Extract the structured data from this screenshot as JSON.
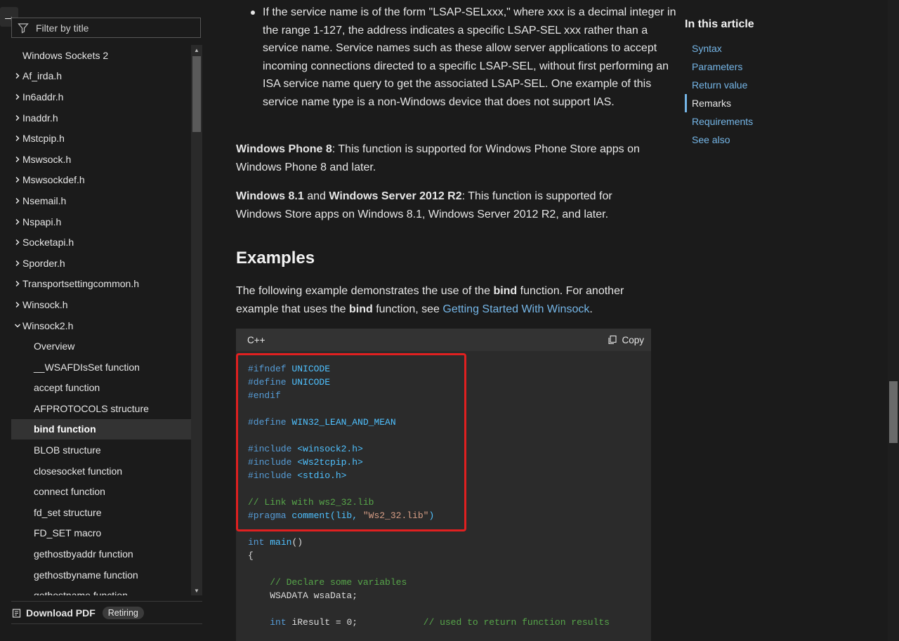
{
  "sidebar": {
    "filter_placeholder": "Filter by title",
    "items": [
      {
        "label": "Windows Sockets 2",
        "level": 0,
        "chevron": ""
      },
      {
        "label": "Af_irda.h",
        "level": 1,
        "chevron": "right"
      },
      {
        "label": "In6addr.h",
        "level": 1,
        "chevron": "right"
      },
      {
        "label": "Inaddr.h",
        "level": 1,
        "chevron": "right"
      },
      {
        "label": "Mstcpip.h",
        "level": 1,
        "chevron": "right"
      },
      {
        "label": "Mswsock.h",
        "level": 1,
        "chevron": "right"
      },
      {
        "label": "Mswsockdef.h",
        "level": 1,
        "chevron": "right"
      },
      {
        "label": "Nsemail.h",
        "level": 1,
        "chevron": "right"
      },
      {
        "label": "Nspapi.h",
        "level": 1,
        "chevron": "right"
      },
      {
        "label": "Socketapi.h",
        "level": 1,
        "chevron": "right"
      },
      {
        "label": "Sporder.h",
        "level": 1,
        "chevron": "right"
      },
      {
        "label": "Transportsettingcommon.h",
        "level": 1,
        "chevron": "right"
      },
      {
        "label": "Winsock.h",
        "level": 1,
        "chevron": "right"
      },
      {
        "label": "Winsock2.h",
        "level": 1,
        "chevron": "down"
      },
      {
        "label": "Overview",
        "level": 2,
        "chevron": ""
      },
      {
        "label": "__WSAFDIsSet function",
        "level": 2,
        "chevron": ""
      },
      {
        "label": "accept function",
        "level": 2,
        "chevron": ""
      },
      {
        "label": "AFPROTOCOLS structure",
        "level": 2,
        "chevron": ""
      },
      {
        "label": "bind function",
        "level": 2,
        "chevron": "",
        "selected": true
      },
      {
        "label": "BLOB structure",
        "level": 2,
        "chevron": ""
      },
      {
        "label": "closesocket function",
        "level": 2,
        "chevron": ""
      },
      {
        "label": "connect function",
        "level": 2,
        "chevron": ""
      },
      {
        "label": "fd_set structure",
        "level": 2,
        "chevron": ""
      },
      {
        "label": "FD_SET macro",
        "level": 2,
        "chevron": ""
      },
      {
        "label": "gethostbyaddr function",
        "level": 2,
        "chevron": ""
      },
      {
        "label": "gethostbyname function",
        "level": 2,
        "chevron": ""
      },
      {
        "label": "gethostname function",
        "level": 2,
        "chevron": ""
      }
    ],
    "download_pdf": "Download PDF",
    "retiring_badge": "Retiring"
  },
  "main": {
    "bullet_text": "If the service name is of the form \"LSAP-SELxxx,\" where xxx is a decimal integer in the range 1-127, the address indicates a specific LSAP-SEL xxx rather than a service name. Service names such as these allow server applications to accept incoming connections directed to a specific LSAP-SEL, without first performing an ISA service name query to get the associated LSAP-SEL. One example of this service name type is a non-Windows device that does not support IAS.",
    "wp8_bold": "Windows Phone 8",
    "wp8_text": ": This function is supported for Windows Phone Store apps on Windows Phone 8 and later.",
    "w81_bold": "Windows 8.1",
    "w81_and": " and ",
    "ws2012_bold": "Windows Server 2012 R2",
    "w81_text": ": This function is supported for Windows Store apps on Windows 8.1, Windows Server 2012 R2, and later.",
    "examples_heading": "Examples",
    "ex_text_1": "The following example demonstrates the use of the ",
    "ex_bold_1": "bind",
    "ex_text_2": " function. For another example that uses the ",
    "ex_bold_2": "bind",
    "ex_text_3": " function, see ",
    "ex_link": "Getting Started With Winsock",
    "ex_text_4": ".",
    "code": {
      "language": "C++",
      "copy_label": "Copy",
      "lines": [
        [
          {
            "t": "#ifndef ",
            "c": "pp"
          },
          {
            "t": "UNICODE",
            "c": "cyan"
          }
        ],
        [
          {
            "t": "#define ",
            "c": "pp"
          },
          {
            "t": "UNICODE",
            "c": "cyan"
          }
        ],
        [
          {
            "t": "#endif",
            "c": "pp"
          }
        ],
        [],
        [
          {
            "t": "#define ",
            "c": "pp"
          },
          {
            "t": "WIN32_LEAN_AND_MEAN",
            "c": "cyan"
          }
        ],
        [],
        [
          {
            "t": "#include ",
            "c": "pp"
          },
          {
            "t": "<winsock2.h>",
            "c": "cyan"
          }
        ],
        [
          {
            "t": "#include ",
            "c": "pp"
          },
          {
            "t": "<Ws2tcpip.h>",
            "c": "cyan"
          }
        ],
        [
          {
            "t": "#include ",
            "c": "pp"
          },
          {
            "t": "<stdio.h>",
            "c": "cyan"
          }
        ],
        [],
        [
          {
            "t": "// Link with ws2_32.lib",
            "c": "cm"
          }
        ],
        [
          {
            "t": "#pragma ",
            "c": "pp"
          },
          {
            "t": "comment(lib, ",
            "c": "cyan"
          },
          {
            "t": "\"Ws2_32.lib\"",
            "c": "str"
          },
          {
            "t": ")",
            "c": "cyan"
          }
        ],
        [],
        [
          {
            "t": "int ",
            "c": "kw"
          },
          {
            "t": "main",
            "c": "cyan"
          },
          {
            "t": "()",
            "c": ""
          }
        ],
        [
          {
            "t": "{",
            "c": ""
          }
        ],
        [],
        [
          {
            "t": "    ",
            "c": ""
          },
          {
            "t": "// Declare some variables",
            "c": "cm"
          }
        ],
        [
          {
            "t": "    WSADATA wsaData;",
            "c": ""
          }
        ],
        [],
        [
          {
            "t": "    ",
            "c": ""
          },
          {
            "t": "int",
            "c": "kw"
          },
          {
            "t": " iResult = 0;            ",
            "c": ""
          },
          {
            "t": "// used to return function results",
            "c": "cm"
          }
        ]
      ]
    }
  },
  "aside": {
    "title": "In this article",
    "items": [
      {
        "label": "Syntax",
        "active": false
      },
      {
        "label": "Parameters",
        "active": false
      },
      {
        "label": "Return value",
        "active": false
      },
      {
        "label": "Remarks",
        "active": true
      },
      {
        "label": "Requirements",
        "active": false
      },
      {
        "label": "See also",
        "active": false
      }
    ]
  }
}
